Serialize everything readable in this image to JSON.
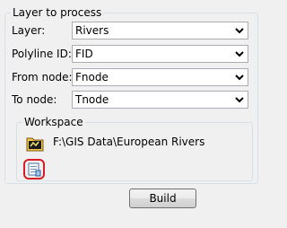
{
  "group": {
    "title": "Layer to process"
  },
  "fields": [
    {
      "label": "Layer:",
      "value": "Rivers"
    },
    {
      "label": "Polyline ID:",
      "value": "FID"
    },
    {
      "label": "From node:",
      "value": "Fnode"
    },
    {
      "label": "To node:",
      "value": "Tnode"
    }
  ],
  "workspace": {
    "title": "Workspace",
    "path": "F:\\GIS Data\\European Rivers",
    "folder_icon": "folder-icon",
    "browse_icon": "browse-icon"
  },
  "build_label": "Build",
  "colors": {
    "highlight": "#d81d25"
  }
}
